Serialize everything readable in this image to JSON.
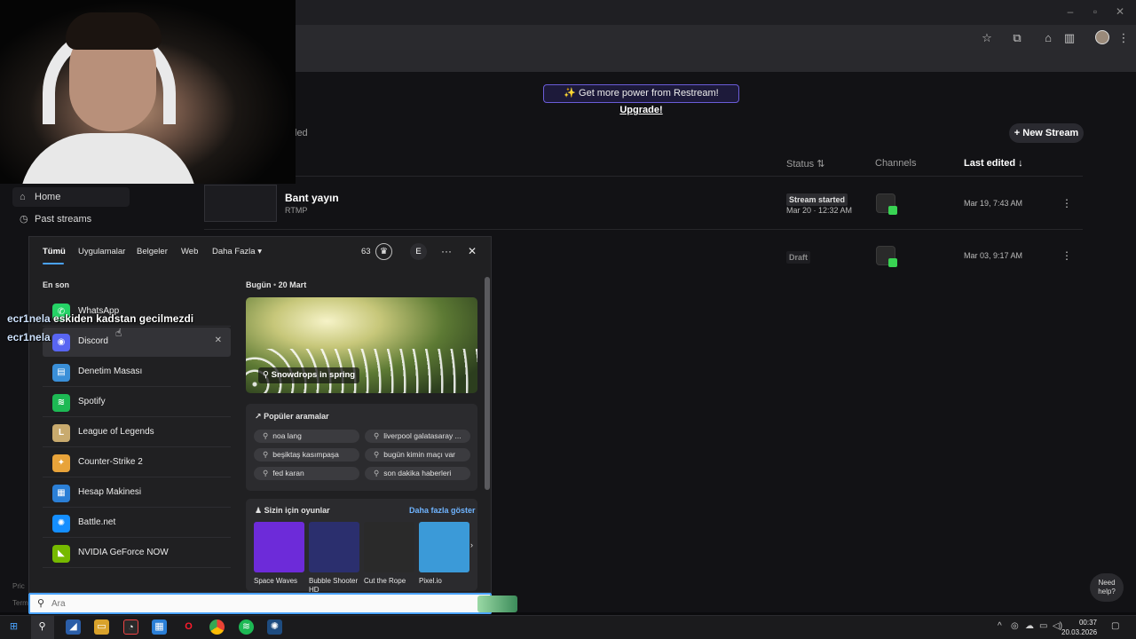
{
  "browser": {
    "window_controls": [
      "–",
      "▫",
      "✕"
    ]
  },
  "restream": {
    "upgrade_banner": {
      "text": "✨ Get more power from Restream!",
      "link": "Upgrade!"
    },
    "tab_partial": "led",
    "new_stream_label": "+ New Stream",
    "columns": {
      "status": "Status ⇅",
      "channels": "Channels",
      "last_edited": "Last edited ↓"
    },
    "streams": [
      {
        "title": "Bant yayın",
        "sub": "RTMP",
        "status": "Stream started",
        "status_date": "Mar 20 · 12:32 AM",
        "last_edited": "Mar 19, 7:43 AM"
      },
      {
        "title": "",
        "sub": "",
        "status": "Draft",
        "status_date": "",
        "last_edited": "Mar 03, 9:17 AM"
      }
    ],
    "sidebar": {
      "home": "Home",
      "past_streams": "Past streams",
      "pricing_partial": "Pric",
      "terms_partial": "Term"
    },
    "need_help": [
      "Need",
      "help?"
    ]
  },
  "chat": [
    {
      "user": "ecr1nela",
      "message": "eskiden kadstan gecilmezdi"
    },
    {
      "user": "ecr1nela",
      "message": ""
    }
  ],
  "search_panel": {
    "tabs": [
      "Tümü",
      "Uygulamalar",
      "Belgeler",
      "Web",
      "Daha Fazla ▾"
    ],
    "points": "63",
    "account_initial": "E",
    "more": "···",
    "close": "✕",
    "recent_title": "En son",
    "apps": [
      {
        "label": "WhatsApp",
        "icon": "whatsapp-icon",
        "color": "#25d366",
        "glyph": "✆"
      },
      {
        "label": "Discord",
        "icon": "discord-icon",
        "color": "#5865f2",
        "glyph": "◉"
      },
      {
        "label": "Denetim Masası",
        "icon": "control-panel-icon",
        "color": "#3a8fd8",
        "glyph": "▤"
      },
      {
        "label": "Spotify",
        "icon": "spotify-icon",
        "color": "#1db954",
        "glyph": "≋"
      },
      {
        "label": "League of Legends",
        "icon": "league-of-legends-icon",
        "color": "#c8aa6e",
        "glyph": "L"
      },
      {
        "label": "Counter-Strike 2",
        "icon": "counter-strike-icon",
        "color": "#e8a33a",
        "glyph": "✦"
      },
      {
        "label": "Hesap Makinesi",
        "icon": "calculator-icon",
        "color": "#2b7fd6",
        "glyph": "▦"
      },
      {
        "label": "Battle.net",
        "icon": "battlenet-icon",
        "color": "#148eff",
        "glyph": "✺"
      },
      {
        "label": "NVIDIA GeForce NOW",
        "icon": "nvidia-icon",
        "color": "#76b900",
        "glyph": "◣"
      }
    ],
    "today_label": "Bugün",
    "today_date": "20 Mart",
    "hero_caption": "Snowdrops in spring",
    "popular_title": "Popüler aramalar",
    "popular_searches": [
      "noa lang",
      "liverpool galatasaray ...",
      "beşiktaş kasımpaşa",
      "bugün kimin maçı var",
      "fed karan",
      "son dakika haberleri"
    ],
    "games_title": "Sizin için oyunlar",
    "games_more": "Daha fazla göster",
    "games": [
      {
        "name": "Space Waves",
        "color": "#6d2bd9"
      },
      {
        "name": "Bubble Shooter HD",
        "color": "#2b2f6e"
      },
      {
        "name": "Cut the Rope",
        "color": "#2a2a2a"
      },
      {
        "name": "Pixel.io",
        "color": "#3b9ad8"
      }
    ],
    "search_placeholder": "Ara"
  },
  "taskbar": {
    "clock_time": "00:37",
    "clock_date": "20.03.2026"
  },
  "colors": {
    "accent": "#4aa3ff",
    "restream_purple": "#6a5cd8",
    "status_green": "#39d353"
  }
}
